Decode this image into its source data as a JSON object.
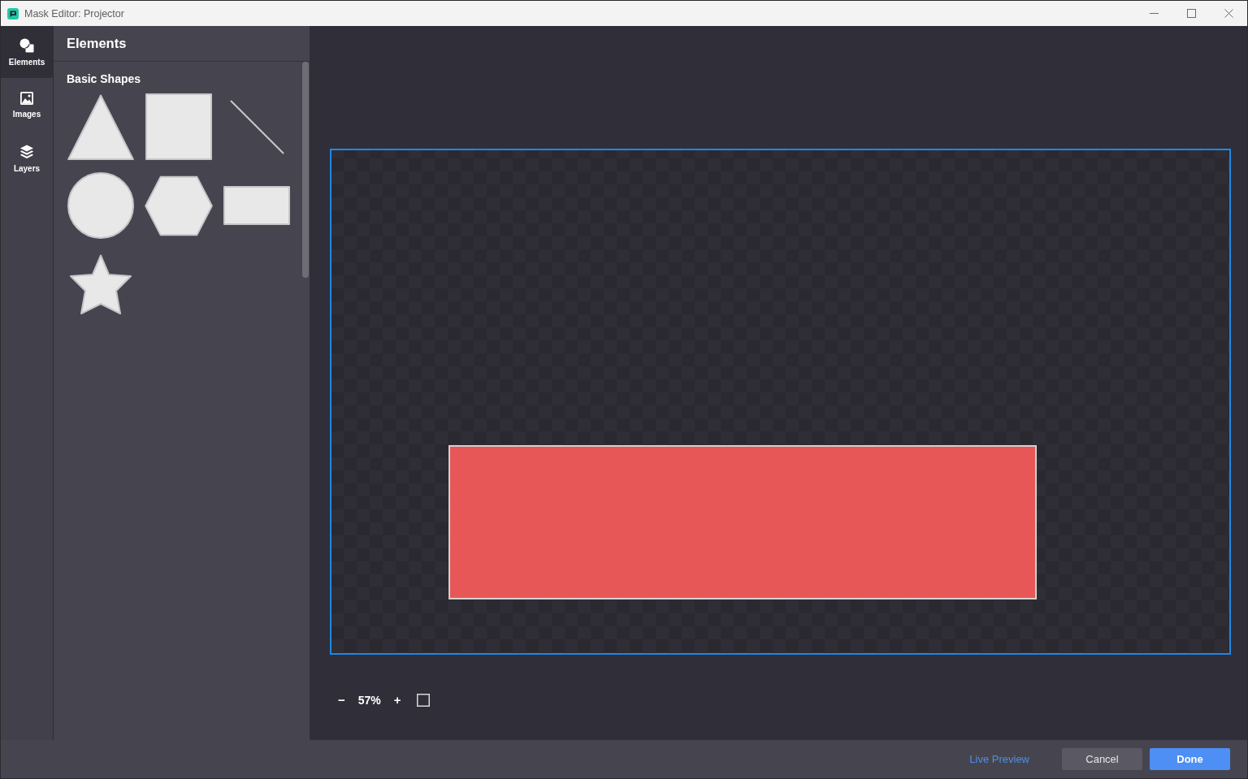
{
  "window": {
    "title": "Mask Editor: Projector"
  },
  "sidebar": {
    "items": [
      {
        "kind": "elements",
        "label": "Elements",
        "selected": true
      },
      {
        "kind": "images",
        "label": "Images",
        "selected": false
      },
      {
        "kind": "layers",
        "label": "Layers",
        "selected": false
      }
    ]
  },
  "panel": {
    "title": "Elements",
    "sections": [
      {
        "title": "Basic Shapes",
        "shapes": [
          {
            "kind": "triangle"
          },
          {
            "kind": "square"
          },
          {
            "kind": "line"
          },
          {
            "kind": "circle"
          },
          {
            "kind": "hexagon"
          },
          {
            "kind": "rectangle"
          },
          {
            "kind": "star"
          }
        ]
      }
    ]
  },
  "canvas": {
    "elements": [
      {
        "kind": "rectangle"
      }
    ]
  },
  "zoom": {
    "zoom_out": "−",
    "value": "57%",
    "zoom_in": "+"
  },
  "footer": {
    "link": "Live Preview",
    "buttons": [
      {
        "kind": "secondary",
        "label": "Cancel"
      },
      {
        "kind": "primary",
        "label": "Done"
      }
    ]
  }
}
